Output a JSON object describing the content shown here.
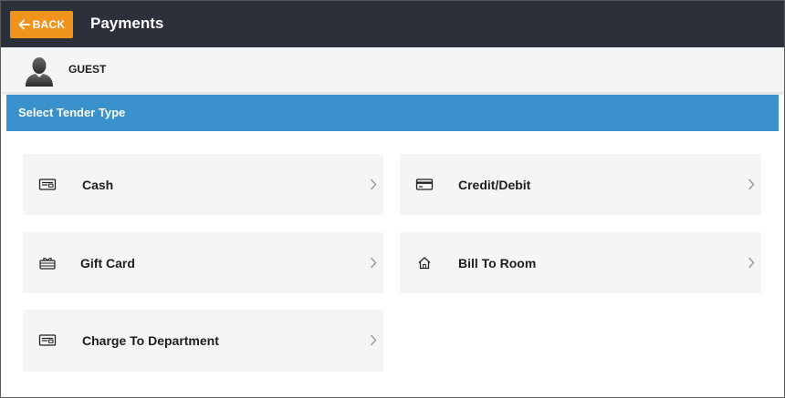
{
  "header": {
    "back_label": "BACK",
    "title": "Payments",
    "bar_color": "#2b303b",
    "back_color": "#f0941e"
  },
  "guest": {
    "name": "GUEST",
    "avatar_icon": "person-silhouette-icon"
  },
  "section": {
    "title": "Select Tender Type",
    "color": "#3a91cc"
  },
  "tenders": [
    {
      "label": "Cash",
      "icon": "cash-card-icon"
    },
    {
      "label": "Credit/Debit",
      "icon": "credit-card-icon"
    },
    {
      "label": "Gift Card",
      "icon": "gift-card-icon"
    },
    {
      "label": "Bill To Room",
      "icon": "home-icon"
    },
    {
      "label": "Charge To Department",
      "icon": "department-card-icon"
    }
  ]
}
